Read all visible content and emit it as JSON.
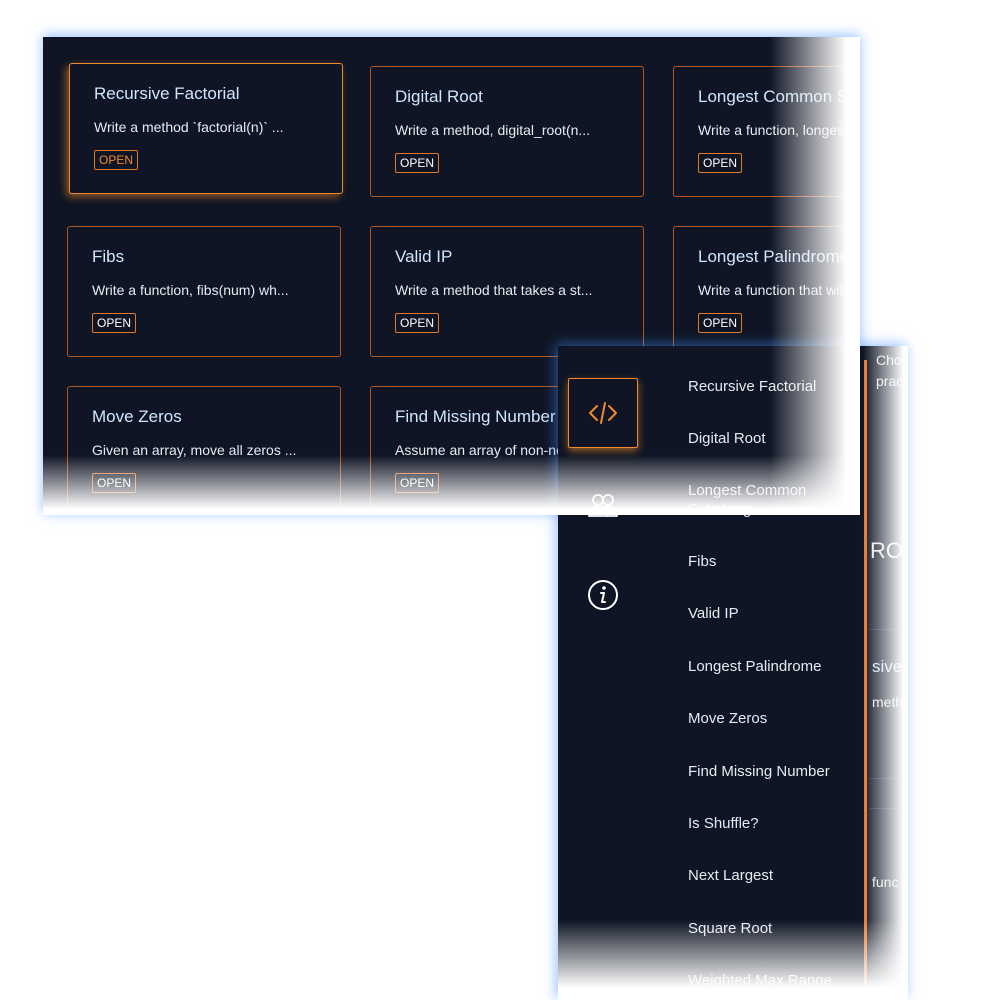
{
  "grid": {
    "cards": [
      {
        "title": "Recursive Factorial",
        "desc": "Write a method `factorial(n)` ...",
        "badge": "OPEN"
      },
      {
        "title": "Digital Root",
        "desc": "Write a method, digital_root(n...",
        "badge": "OPEN"
      },
      {
        "title": "Longest Common Substring",
        "desc": "Write a function, longest_common_s...",
        "badge": "OPEN"
      },
      {
        "title": "Fibs",
        "desc": "Write a function, fibs(num) wh...",
        "badge": "OPEN"
      },
      {
        "title": "Valid IP",
        "desc": "Write a method that takes a st...",
        "badge": "OPEN"
      },
      {
        "title": "Longest Palindrome",
        "desc": "Write a function that will find...",
        "badge": "OPEN"
      },
      {
        "title": "Move Zeros",
        "desc": "Given an array, move all zeros ...",
        "badge": "OPEN"
      },
      {
        "title": "Find Missing Number",
        "desc": "Assume an array of non-ne...",
        "badge": "OPEN"
      }
    ]
  },
  "sidebar": {
    "icons": [
      "code-icon",
      "users-icon",
      "info-icon"
    ],
    "items": [
      {
        "label": "Recursive Factorial"
      },
      {
        "label": "Digital Root"
      },
      {
        "label": "Longest Common Substring"
      },
      {
        "label": "Fibs"
      },
      {
        "label": "Valid IP"
      },
      {
        "label": "Longest Palindrome"
      },
      {
        "label": "Move Zeros"
      },
      {
        "label": "Find Missing Number"
      },
      {
        "label": "Is Shuffle?"
      },
      {
        "label": "Next Largest"
      },
      {
        "label": "Square Root"
      },
      {
        "label": "Weighted Max Range"
      }
    ]
  },
  "peek": {
    "line1": "Choo",
    "line2": "pract",
    "heading": "RO",
    "title_frag": "sive",
    "desc_frag": "meth",
    "desc_frag2": "func"
  },
  "colors": {
    "bg": "#0f1524",
    "accent": "#f08a2a",
    "border": "#b3561e",
    "title": "#cfe6ff",
    "text": "#e6ebf2"
  }
}
